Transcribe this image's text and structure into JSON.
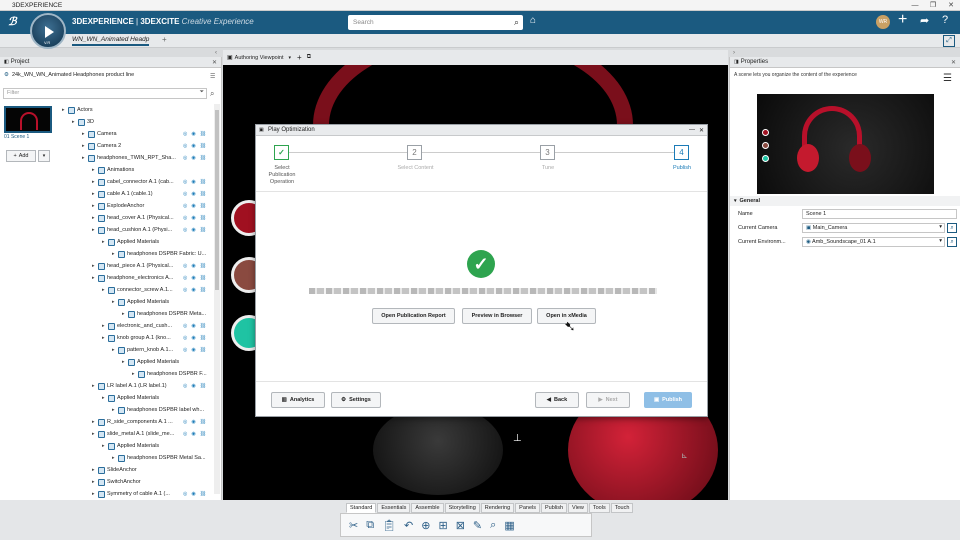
{
  "window": {
    "title": "3DEXPERIENCE",
    "controls": [
      "—",
      "❐",
      "✕"
    ]
  },
  "brand": {
    "part1": "3DEXPERIENCE",
    "separator": " | ",
    "part2": "3DEXCITE",
    "sub": " Creative Experience",
    "version": "V.R"
  },
  "search": {
    "placeholder": "Search"
  },
  "topbar_icons": [
    "tag-icon",
    "user-avatar",
    "plus-icon",
    "share-icon",
    "help-icon"
  ],
  "user_initials": "WR",
  "tab": {
    "name": "WN_WN_Animated Headp",
    "add": "+"
  },
  "viewport_toolbar": {
    "viewpoint": "Authoring Viewpoint"
  },
  "project_panel": {
    "title": "Project",
    "product": "24k_WN_WN_Animated Headphones product line",
    "filter_placeholder": "Filter",
    "scene_label": "Scene 1",
    "add_label": "Add"
  },
  "tree": [
    {
      "d": 0,
      "label": "Actors",
      "icons": false
    },
    {
      "d": 1,
      "label": "3D",
      "icons": false
    },
    {
      "d": 2,
      "label": "Camera",
      "icons": true
    },
    {
      "d": 2,
      "label": "Camera 2",
      "icons": true
    },
    {
      "d": 2,
      "label": "headphones_TWIN_RPT_Sha...",
      "icons": true
    },
    {
      "d": 3,
      "label": "Animations",
      "icons": false
    },
    {
      "d": 3,
      "label": "cabel_connector A.1 (cab...",
      "icons": true
    },
    {
      "d": 3,
      "label": "cable A.1 (cable.1)",
      "icons": true
    },
    {
      "d": 3,
      "label": "ExplodeAnchor",
      "icons": true
    },
    {
      "d": 3,
      "label": "head_cover A.1 (Physical...",
      "icons": true
    },
    {
      "d": 3,
      "label": "head_cushion A.1 (Physi...",
      "icons": true
    },
    {
      "d": 4,
      "label": "Applied Materials",
      "icons": false
    },
    {
      "d": 5,
      "label": "headphones DSPBR Fabric: U...",
      "icons": false
    },
    {
      "d": 3,
      "label": "head_piece A.1 (Physical...",
      "icons": true
    },
    {
      "d": 3,
      "label": "headphone_electronics A...",
      "icons": true
    },
    {
      "d": 4,
      "label": "connector_screw A.1...",
      "icons": true
    },
    {
      "d": 5,
      "label": "Applied Materials",
      "icons": false
    },
    {
      "d": 6,
      "label": "headphones DSPBR Meta...",
      "icons": false
    },
    {
      "d": 4,
      "label": "electronic_and_cush...",
      "icons": true
    },
    {
      "d": 4,
      "label": "knob group A.1 (kno...",
      "icons": true
    },
    {
      "d": 5,
      "label": "pattern_knob A.1...",
      "icons": true
    },
    {
      "d": 6,
      "label": "Applied Materials",
      "icons": false
    },
    {
      "d": 7,
      "label": "headphones DSPBR F...",
      "icons": false
    },
    {
      "d": 3,
      "label": "LR label A.1 (LR label.1)",
      "icons": true
    },
    {
      "d": 4,
      "label": "Applied Materials",
      "icons": false
    },
    {
      "d": 5,
      "label": "headphones DSPBR label wh...",
      "icons": false
    },
    {
      "d": 3,
      "label": "R_side_components A.1 ...",
      "icons": true
    },
    {
      "d": 3,
      "label": "slide_metal A.1 (slide_me...",
      "icons": true
    },
    {
      "d": 4,
      "label": "Applied Materials",
      "icons": false
    },
    {
      "d": 5,
      "label": "headphones DSPBR Metal Sa...",
      "icons": false
    },
    {
      "d": 3,
      "label": "SlideAnchor",
      "icons": false
    },
    {
      "d": 3,
      "label": "SwitchAnchor",
      "icons": false
    },
    {
      "d": 3,
      "label": "Symmetry of cable A.1 (...",
      "icons": true
    }
  ],
  "dialog": {
    "title": "Play Optimization",
    "steps": [
      {
        "num": "✓",
        "label": "Select\nPublication\nOperation"
      },
      {
        "num": "2",
        "label": "Select Content"
      },
      {
        "num": "3",
        "label": "Tune"
      },
      {
        "num": "4",
        "label": "Publish"
      }
    ],
    "buttons": {
      "report": "Open Publication Report",
      "preview": "Preview in Browser",
      "xmedia": "Open in xMedia",
      "analytics": "Analytics",
      "settings": "Settings",
      "back": "Back",
      "next": "Next",
      "publish": "Publish"
    }
  },
  "properties": {
    "title": "Properties",
    "description": "A scene lets you organize the content of the experience",
    "section": "General",
    "fields": [
      {
        "label": "Name",
        "value": "Scene 1"
      },
      {
        "label": "Current Camera",
        "value": "Main_Camera"
      },
      {
        "label": "Current Environm...",
        "value": "Amb_Soundscape_01 A.1"
      }
    ]
  },
  "bottom_tabs": [
    "Standard",
    "Essentials",
    "Assemble",
    "Storytelling",
    "Rendering",
    "Panels",
    "Publish",
    "View",
    "Tools",
    "Touch"
  ],
  "colors": {
    "accent": "#1b5a80",
    "success": "#2ea44f",
    "publish": "#8fbfe6",
    "red": "#c8102e",
    "teal": "#1fc3a3"
  }
}
